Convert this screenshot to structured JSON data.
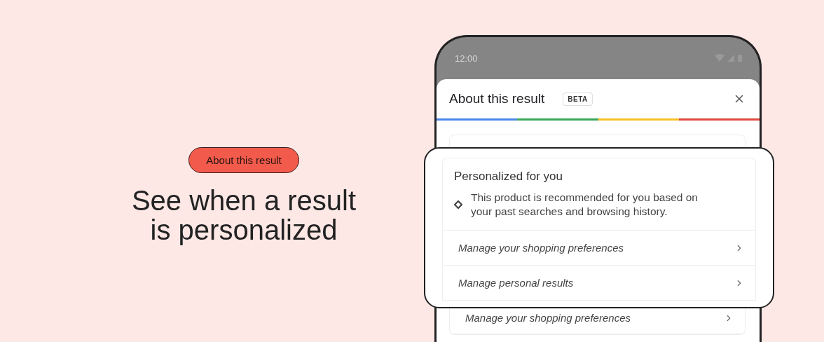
{
  "promo": {
    "tag": "About this result",
    "headline_lines": [
      "See when a result",
      "is personalized"
    ]
  },
  "phone": {
    "status_time": "12:00",
    "sheet": {
      "title": "About this result",
      "badge": "BETA"
    },
    "list_rows": [
      {
        "label": "Manage your shopping preferences"
      }
    ]
  },
  "callout": {
    "title": "Personalized for you",
    "description": "This product is recommended for you based on your past searches and browsing history.",
    "links": [
      {
        "label": "Manage your shopping preferences"
      },
      {
        "label": "Manage personal results"
      }
    ]
  }
}
